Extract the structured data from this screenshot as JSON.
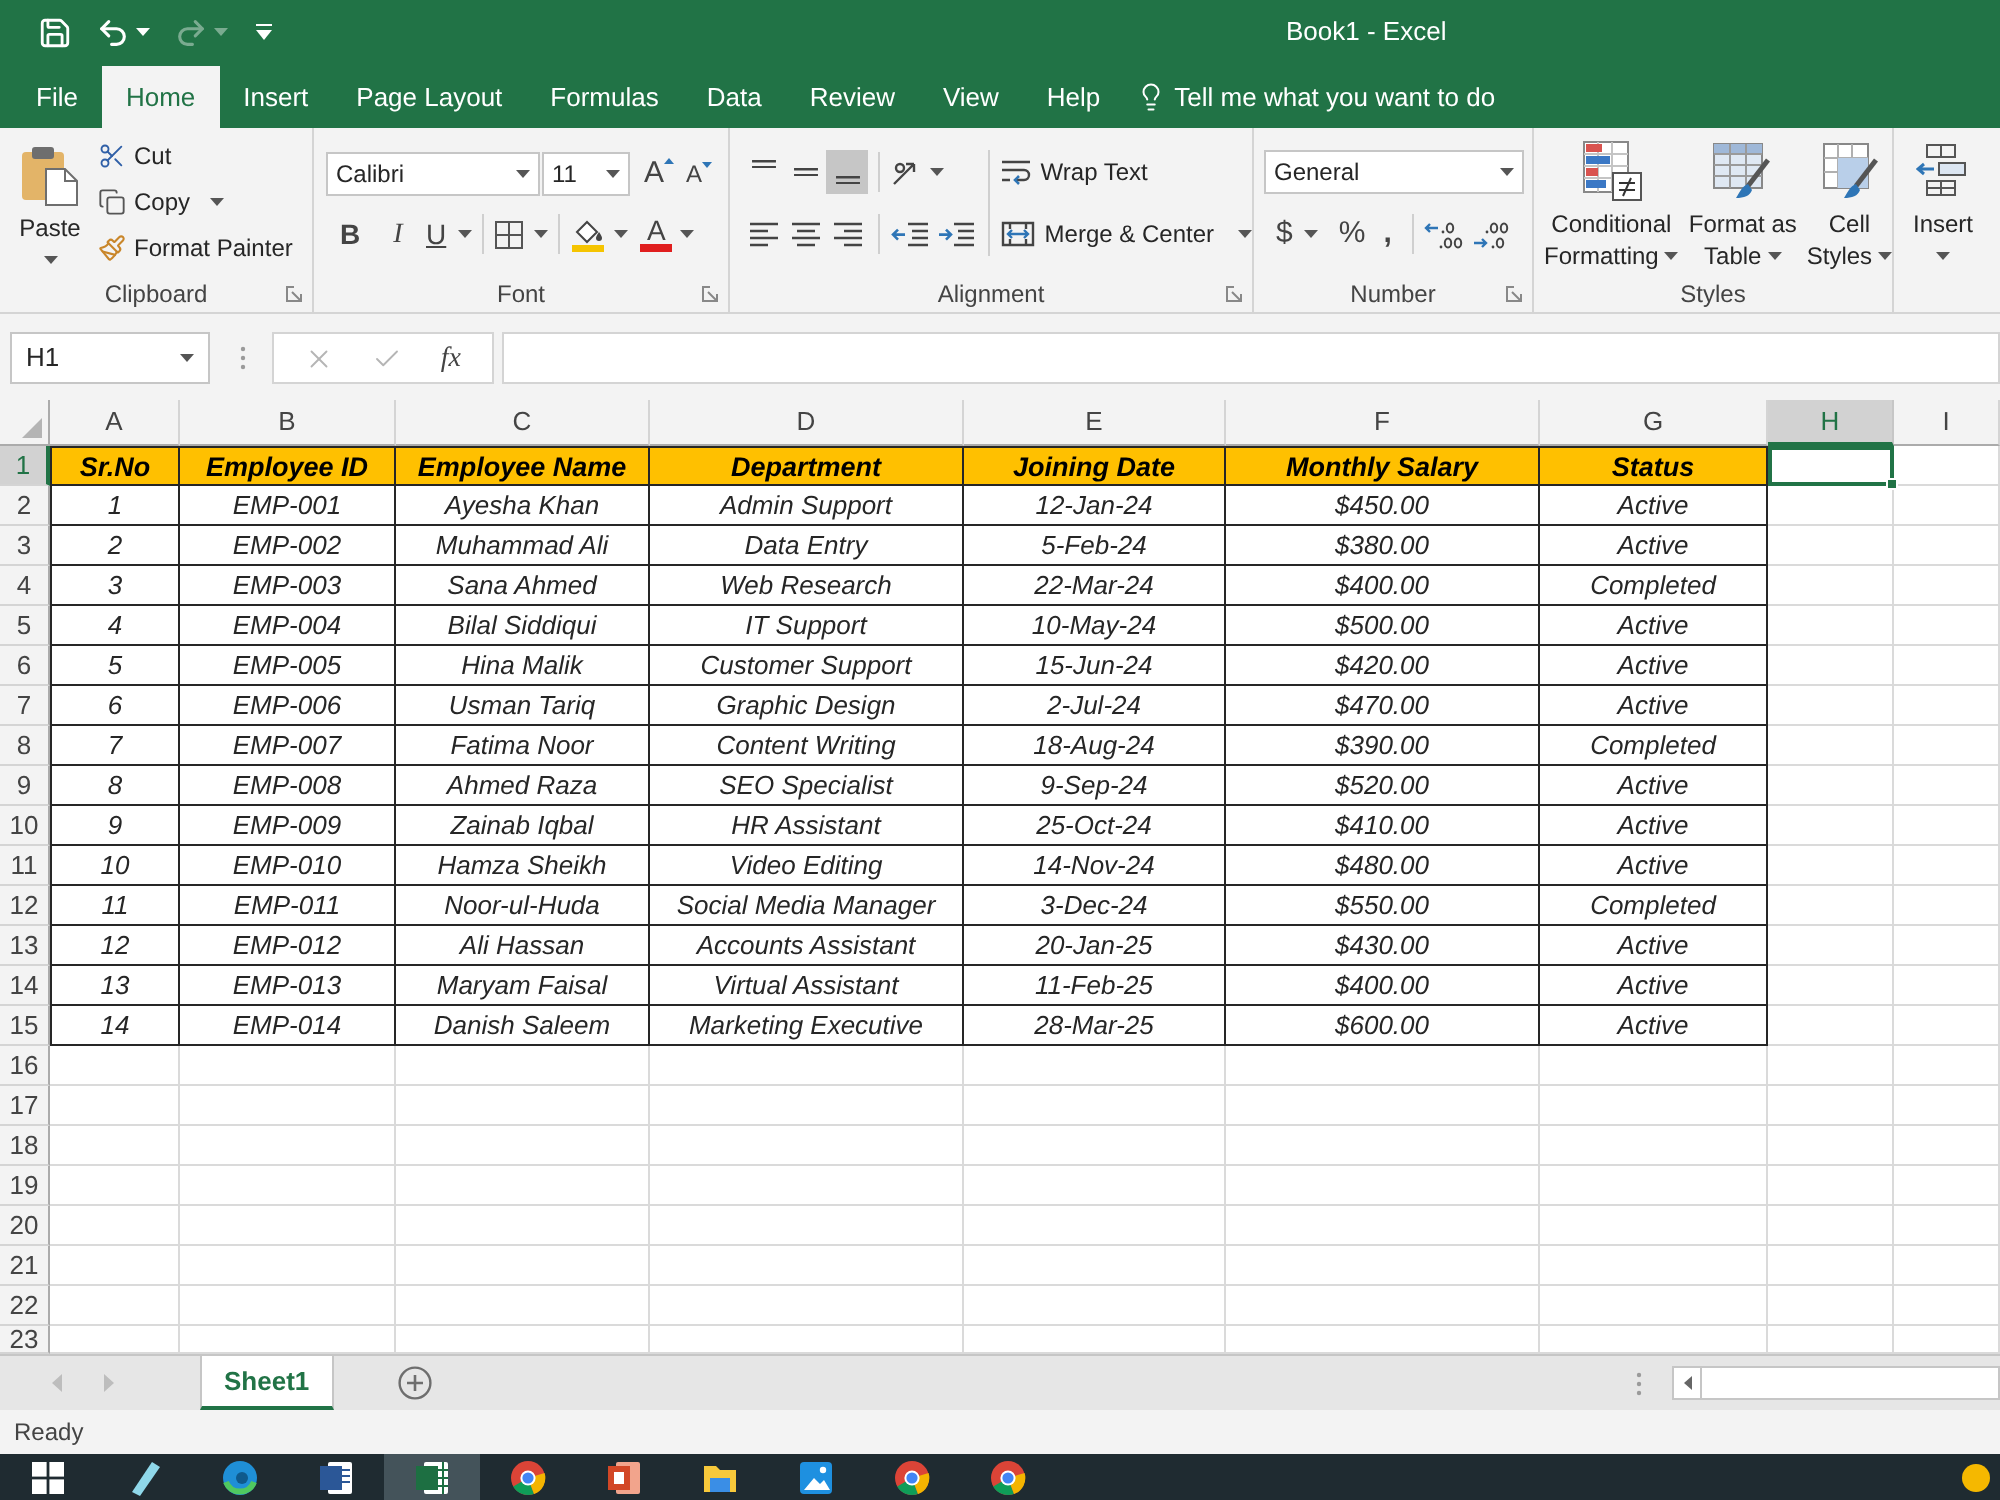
{
  "window": {
    "title": "Book1 - Excel"
  },
  "quick_access": [
    {
      "kind": "save",
      "disabled": false
    },
    {
      "kind": "undo",
      "disabled": false
    },
    {
      "kind": "redo",
      "disabled": true
    },
    {
      "kind": "customize",
      "disabled": false
    }
  ],
  "ribbon_tabs": [
    {
      "label": "File",
      "selected": false
    },
    {
      "label": "Home",
      "selected": true
    },
    {
      "label": "Insert",
      "selected": false
    },
    {
      "label": "Page Layout",
      "selected": false
    },
    {
      "label": "Formulas",
      "selected": false
    },
    {
      "label": "Data",
      "selected": false
    },
    {
      "label": "Review",
      "selected": false
    },
    {
      "label": "View",
      "selected": false
    },
    {
      "label": "Help",
      "selected": false
    }
  ],
  "tell_me": "Tell me what you want to do",
  "ribbon": {
    "clipboard": {
      "label": "Clipboard",
      "paste": "Paste",
      "cut": "Cut",
      "copy": "Copy",
      "format_painter": "Format Painter"
    },
    "font": {
      "label": "Font",
      "name": "Calibri",
      "size": "11",
      "grow": "A",
      "shrink": "A",
      "bold": "B",
      "italic": "I",
      "underline": "U",
      "font_color": "A"
    },
    "alignment": {
      "label": "Alignment",
      "vertical": [
        {
          "kind": "top",
          "selected": false
        },
        {
          "kind": "middle",
          "selected": false
        },
        {
          "kind": "bottom",
          "selected": true
        }
      ],
      "horizontal": [
        {
          "kind": "left",
          "selected": false
        },
        {
          "kind": "center",
          "selected": false
        },
        {
          "kind": "right",
          "selected": false
        }
      ],
      "wrap_text": "Wrap Text",
      "merge_center": "Merge & Center"
    },
    "number": {
      "label": "Number",
      "format": "General",
      "currency": "$",
      "percent": "%",
      "comma": ","
    },
    "styles": {
      "label": "Styles",
      "buttons": [
        {
          "kind": "conditional",
          "lines": [
            "Conditional",
            "Formatting"
          ]
        },
        {
          "kind": "table",
          "lines": [
            "Format as",
            "Table"
          ]
        },
        {
          "kind": "cell",
          "lines": [
            "Cell",
            "Styles"
          ]
        }
      ]
    },
    "cells": {
      "insert": "Insert"
    }
  },
  "formula_bar": {
    "name_box": "H1",
    "buttons": [
      {
        "kind": "cancel",
        "disabled": true
      },
      {
        "kind": "enter",
        "disabled": true
      }
    ],
    "function": "fx"
  },
  "sheet": {
    "column_headers": [
      {
        "label": "A",
        "selected": false
      },
      {
        "label": "B",
        "selected": false
      },
      {
        "label": "C",
        "selected": false
      },
      {
        "label": "D",
        "selected": false
      },
      {
        "label": "E",
        "selected": false
      },
      {
        "label": "F",
        "selected": false
      },
      {
        "label": "G",
        "selected": false
      },
      {
        "label": "H",
        "selected": true
      },
      {
        "label": "I",
        "selected": false
      }
    ],
    "row_headers": [
      {
        "label": "1",
        "selected": true
      },
      {
        "label": "2",
        "selected": false
      },
      {
        "label": "3",
        "selected": false
      },
      {
        "label": "4",
        "selected": false
      },
      {
        "label": "5",
        "selected": false
      },
      {
        "label": "6",
        "selected": false
      },
      {
        "label": "7",
        "selected": false
      },
      {
        "label": "8",
        "selected": false
      },
      {
        "label": "9",
        "selected": false
      },
      {
        "label": "10",
        "selected": false
      },
      {
        "label": "11",
        "selected": false
      },
      {
        "label": "12",
        "selected": false
      },
      {
        "label": "13",
        "selected": false
      },
      {
        "label": "14",
        "selected": false
      },
      {
        "label": "15",
        "selected": false
      },
      {
        "label": "16",
        "selected": false
      },
      {
        "label": "17",
        "selected": false
      },
      {
        "label": "18",
        "selected": false
      },
      {
        "label": "19",
        "selected": false
      },
      {
        "label": "20",
        "selected": false
      },
      {
        "label": "21",
        "selected": false
      },
      {
        "label": "22",
        "selected": false
      },
      {
        "label": "23",
        "selected": false
      }
    ],
    "table": {
      "header": [
        "Sr.No",
        "Employee ID",
        "Employee Name",
        "Department",
        "Joining Date",
        "Monthly Salary",
        "Status"
      ],
      "rows": [
        [
          "1",
          "EMP-001",
          "Ayesha Khan",
          "Admin Support",
          "12-Jan-24",
          "$450.00",
          "Active"
        ],
        [
          "2",
          "EMP-002",
          "Muhammad Ali",
          "Data Entry",
          "5-Feb-24",
          "$380.00",
          "Active"
        ],
        [
          "3",
          "EMP-003",
          "Sana Ahmed",
          "Web Research",
          "22-Mar-24",
          "$400.00",
          "Completed"
        ],
        [
          "4",
          "EMP-004",
          "Bilal Siddiqui",
          "IT Support",
          "10-May-24",
          "$500.00",
          "Active"
        ],
        [
          "5",
          "EMP-005",
          "Hina Malik",
          "Customer Support",
          "15-Jun-24",
          "$420.00",
          "Active"
        ],
        [
          "6",
          "EMP-006",
          "Usman Tariq",
          "Graphic Design",
          "2-Jul-24",
          "$470.00",
          "Active"
        ],
        [
          "7",
          "EMP-007",
          "Fatima Noor",
          "Content Writing",
          "18-Aug-24",
          "$390.00",
          "Completed"
        ],
        [
          "8",
          "EMP-008",
          "Ahmed Raza",
          "SEO Specialist",
          "9-Sep-24",
          "$520.00",
          "Active"
        ],
        [
          "9",
          "EMP-009",
          "Zainab Iqbal",
          "HR Assistant",
          "25-Oct-24",
          "$410.00",
          "Active"
        ],
        [
          "10",
          "EMP-010",
          "Hamza Sheikh",
          "Video Editing",
          "14-Nov-24",
          "$480.00",
          "Active"
        ],
        [
          "11",
          "EMP-011",
          "Noor-ul-Huda",
          "Social Media Manager",
          "3-Dec-24",
          "$550.00",
          "Completed"
        ],
        [
          "12",
          "EMP-012",
          "Ali Hassan",
          "Accounts Assistant",
          "20-Jan-25",
          "$430.00",
          "Active"
        ],
        [
          "13",
          "EMP-013",
          "Maryam Faisal",
          "Virtual Assistant",
          "11-Feb-25",
          "$400.00",
          "Active"
        ],
        [
          "14",
          "EMP-014",
          "Danish Saleem",
          "Marketing Executive",
          "28-Mar-25",
          "$600.00",
          "Active"
        ]
      ]
    }
  },
  "sheet_nav": [
    {
      "kind": "previous",
      "disabled": true
    },
    {
      "kind": "next",
      "disabled": true
    }
  ],
  "sheet_tabs": [
    {
      "label": "Sheet1",
      "selected": true
    }
  ],
  "status_bar": {
    "text": "Ready"
  },
  "taskbar": [
    {
      "kind": "start",
      "selected": false
    },
    {
      "kind": "pen",
      "selected": false
    },
    {
      "kind": "swirl",
      "selected": false
    },
    {
      "kind": "document",
      "selected": false
    },
    {
      "kind": "spreadsheet",
      "selected": true
    },
    {
      "kind": "wheel",
      "selected": false
    },
    {
      "kind": "slides",
      "selected": false
    },
    {
      "kind": "folder",
      "selected": false
    },
    {
      "kind": "mountain",
      "selected": false
    },
    {
      "kind": "wheel",
      "selected": false
    },
    {
      "kind": "wheel",
      "selected": false
    },
    {
      "kind": "orb",
      "selected": false
    }
  ]
}
